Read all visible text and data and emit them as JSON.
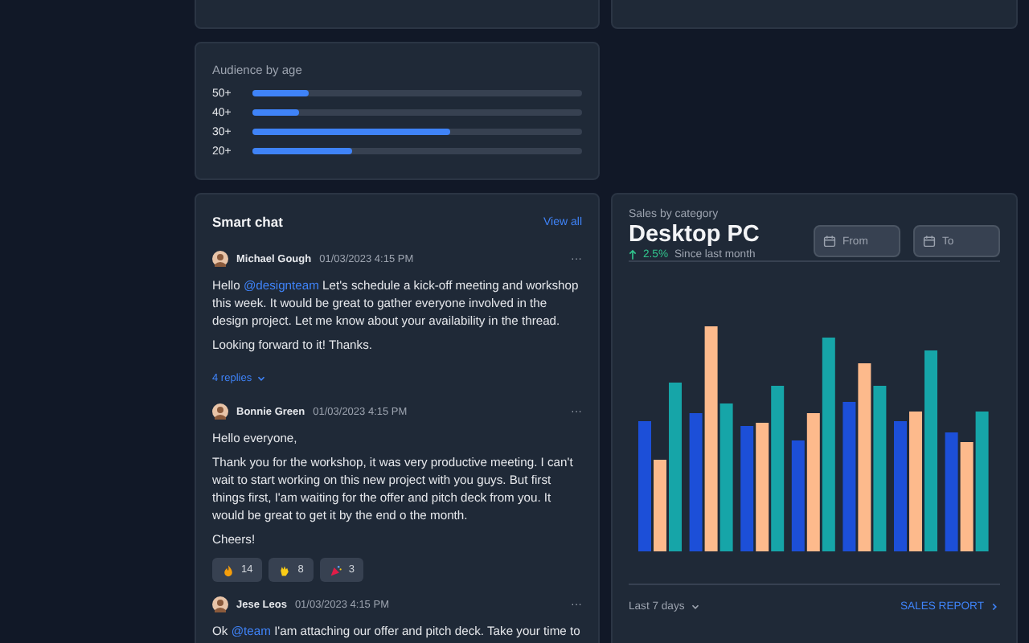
{
  "audience": {
    "title": "Audience by age",
    "rows": [
      {
        "label": "50+",
        "level": 0.17
      },
      {
        "label": "40+",
        "level": 0.14
      },
      {
        "label": "30+",
        "level": 0.6
      },
      {
        "label": "20+",
        "level": 0.3
      }
    ]
  },
  "chat": {
    "title": "Smart chat",
    "view_all": "View all",
    "messages": [
      {
        "author": "Michael Gough",
        "time": "01/03/2023 4:15 PM",
        "menu": "···",
        "paragraphs": [
          [
            {
              "kind": "text",
              "text": "Hello"
            },
            {
              "kind": "mention",
              "text": "@designteam"
            },
            {
              "kind": "text",
              "text": "Let's schedule a kick-off meeting and workshop this week. It would be great to gather everyone involved in the design project. Let me know about your availability in the thread."
            }
          ],
          [
            {
              "kind": "text",
              "text": "Looking forward to it! Thanks."
            }
          ]
        ],
        "replies": "4 replies"
      },
      {
        "author": "Bonnie Green",
        "time": "01/03/2023 4:15 PM",
        "menu": "···",
        "paragraphs": [
          [
            {
              "kind": "text",
              "text": "Hello everyone,"
            }
          ],
          [
            {
              "kind": "text",
              "text": "Thank you for the workshop, it was very productive meeting. I can't wait to start working on this new project with you guys. But first things first, I'am waiting for the offer and pitch deck from you. It would be great to get it by the end o the month."
            }
          ],
          [
            {
              "kind": "text",
              "text": "Cheers!"
            }
          ]
        ],
        "reactions": [
          {
            "kind": "fire",
            "count": "14"
          },
          {
            "kind": "clap",
            "count": "8"
          },
          {
            "kind": "party",
            "count": "3"
          }
        ]
      },
      {
        "author": "Jese Leos",
        "time": "01/03/2023 4:15 PM",
        "menu": "···",
        "paragraphs": [
          [
            {
              "kind": "text",
              "text": "Ok"
            },
            {
              "kind": "mention",
              "text": "@team"
            },
            {
              "kind": "text",
              "text": "I'am attaching our offer and pitch deck. Take your time to"
            }
          ]
        ]
      }
    ]
  },
  "sales": {
    "subtitle": "Sales by category",
    "title": "Desktop PC",
    "change": "2.5%",
    "change_note": "Since last month",
    "from": {
      "placeholder": "From"
    },
    "to": {
      "placeholder": "To"
    },
    "range": "Last 7 days",
    "report": "SALES REPORT"
  }
}
